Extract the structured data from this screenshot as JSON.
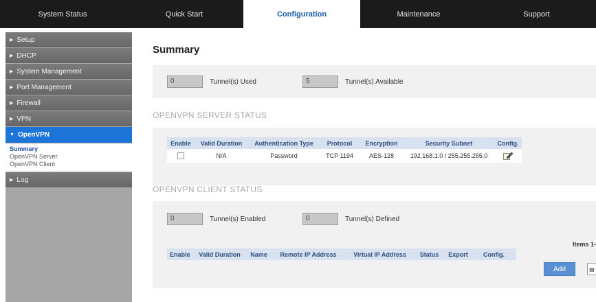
{
  "topnav": {
    "tabs": [
      {
        "label": "System Status",
        "active": false
      },
      {
        "label": "Quick Start",
        "active": false
      },
      {
        "label": "Configuration",
        "active": true
      },
      {
        "label": "Maintenance",
        "active": false
      },
      {
        "label": "Support",
        "active": false
      }
    ]
  },
  "sidebar": {
    "items": [
      {
        "label": "Setup"
      },
      {
        "label": "DHCP"
      },
      {
        "label": "System Management"
      },
      {
        "label": "Port Management"
      },
      {
        "label": "Firewall"
      },
      {
        "label": "VPN"
      },
      {
        "label": "OpenVPN",
        "active": true
      },
      {
        "label": "Log"
      }
    ],
    "sub_items": [
      {
        "label": "Summary",
        "current": true
      },
      {
        "label": "OpenVPN Server"
      },
      {
        "label": "OpenVPN Client"
      }
    ]
  },
  "main": {
    "title": "Summary",
    "tunnels": {
      "used_value": "0",
      "used_label": "Tunnel(s) Used",
      "available_value": "5",
      "available_label": "Tunnel(s) Available"
    },
    "server_status": {
      "heading": "OPENVPN SERVER STATUS",
      "columns": [
        "Enable",
        "Valid Duration",
        "Authentication Type",
        "Protocol",
        "Encryption",
        "Security Subnet",
        "Config."
      ],
      "row": {
        "valid_duration": "N/A",
        "auth_type": "Password",
        "protocol": "TCP 1194",
        "encryption": "AES-128",
        "security_subnet": "192.168.1.0 / 255.255.255.0",
        "config_icon": "edit-icon"
      }
    },
    "client_status": {
      "heading": "OPENVPN CLIENT STATUS",
      "enabled_value": "0",
      "enabled_label": "Tunnel(s) Enabled",
      "defined_value": "0",
      "defined_label": "Tunnel(s) Defined",
      "items_label": "Items 1-",
      "columns": [
        "Enable",
        "Valid Duration",
        "Name",
        "Remote IP Address",
        "Virtual IP Address",
        "Status",
        "Export",
        "Config."
      ],
      "add_label": "Add"
    }
  },
  "colors": {
    "accent": "#1c73d8",
    "topnav_bg": "#1b1b1b",
    "table_header": "#d7e1ef",
    "panel_bg": "#f1f1f1"
  }
}
